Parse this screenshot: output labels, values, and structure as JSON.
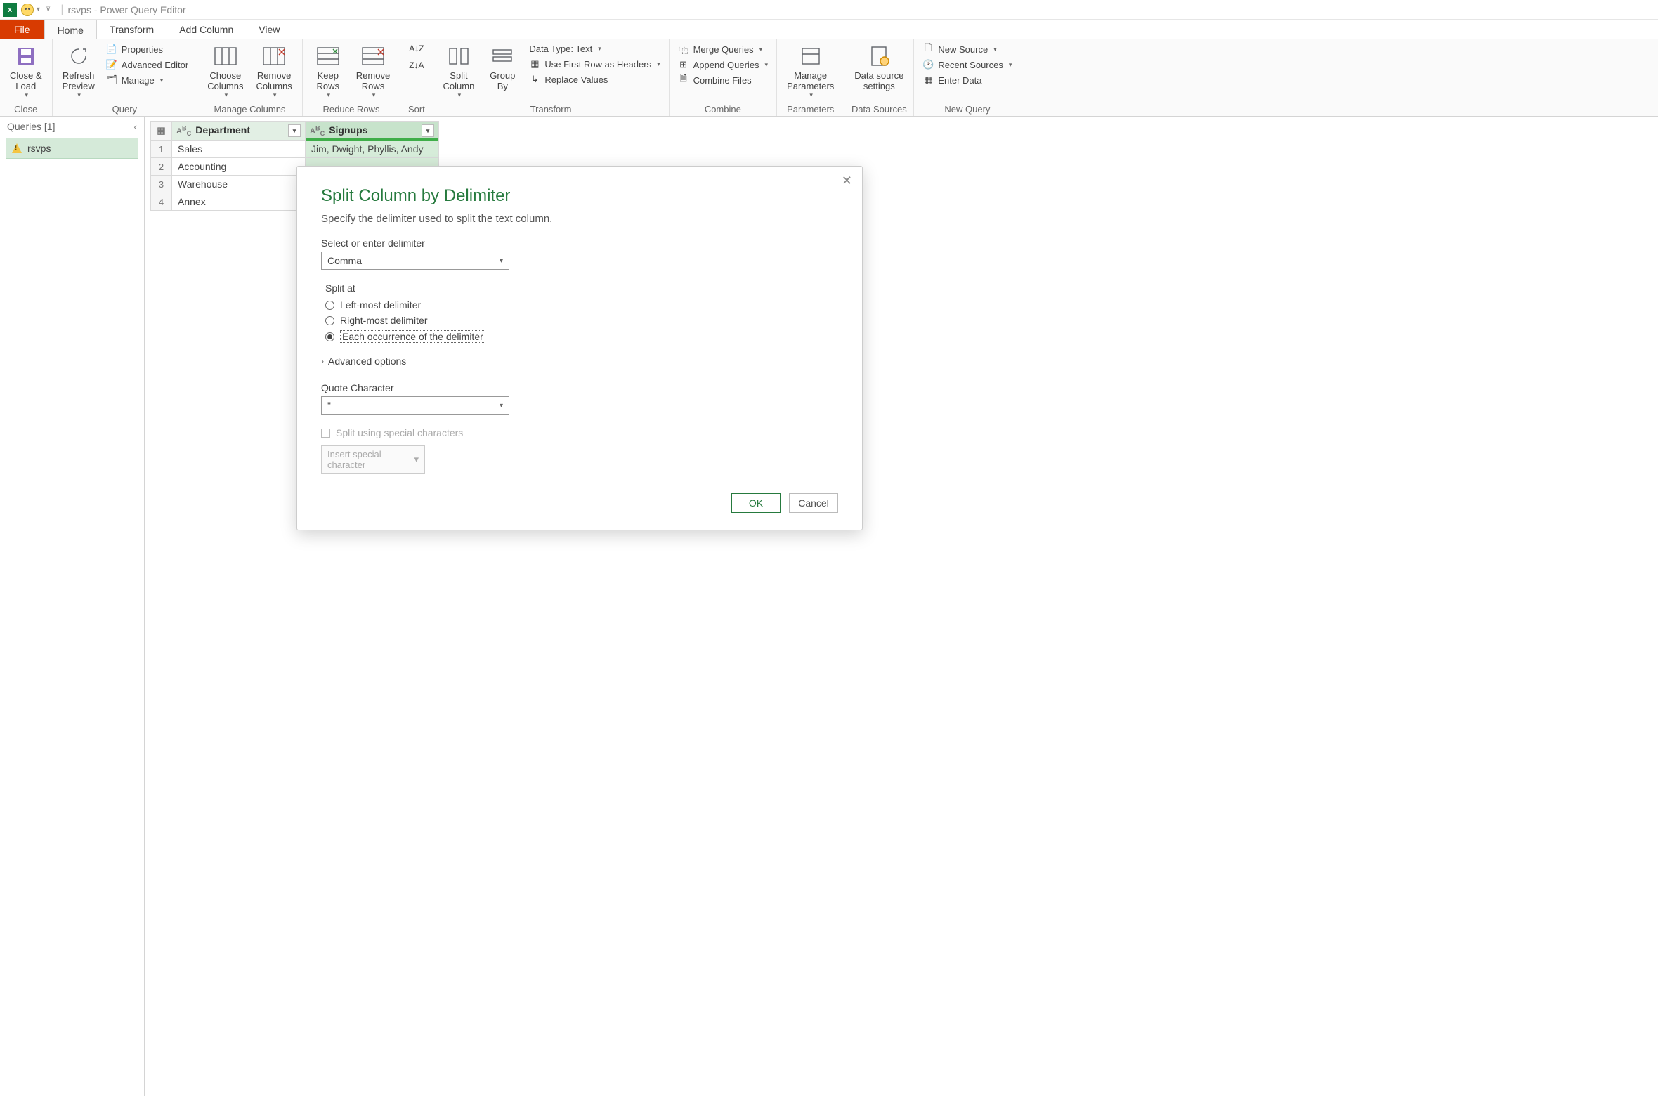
{
  "titlebar": {
    "title": "rsvps - Power Query Editor"
  },
  "tabs": {
    "file": "File",
    "home": "Home",
    "transform": "Transform",
    "addColumn": "Add Column",
    "view": "View"
  },
  "ribbon": {
    "close": {
      "closeLoad": "Close &\nLoad",
      "group": "Close"
    },
    "query": {
      "refresh": "Refresh\nPreview",
      "properties": "Properties",
      "advanced": "Advanced Editor",
      "manage": "Manage",
      "group": "Query"
    },
    "manageCols": {
      "choose": "Choose\nColumns",
      "remove": "Remove\nColumns",
      "group": "Manage Columns"
    },
    "reduce": {
      "keep": "Keep\nRows",
      "remove": "Remove\nRows",
      "group": "Reduce Rows"
    },
    "sort": {
      "group": "Sort"
    },
    "transform": {
      "split": "Split\nColumn",
      "groupBy": "Group\nBy",
      "dataType": "Data Type: Text",
      "firstRow": "Use First Row as Headers",
      "replace": "Replace Values",
      "group": "Transform"
    },
    "combine": {
      "merge": "Merge Queries",
      "append": "Append Queries",
      "files": "Combine Files",
      "group": "Combine"
    },
    "params": {
      "manage": "Manage\nParameters",
      "group": "Parameters"
    },
    "dataSources": {
      "settings": "Data source\nsettings",
      "group": "Data Sources"
    },
    "newQuery": {
      "newSource": "New Source",
      "recent": "Recent Sources",
      "enter": "Enter Data",
      "group": "New Query"
    }
  },
  "sidebar": {
    "header": "Queries [1]",
    "item": "rsvps"
  },
  "grid": {
    "columns": [
      {
        "type": "ABC",
        "name": "Department"
      },
      {
        "type": "ABC",
        "name": "Signups"
      }
    ],
    "rows": [
      {
        "n": "1",
        "c1": "Sales",
        "c2": "Jim, Dwight, Phyllis, Andy"
      },
      {
        "n": "2",
        "c1": "Accounting",
        "c2": ""
      },
      {
        "n": "3",
        "c1": "Warehouse",
        "c2": ""
      },
      {
        "n": "4",
        "c1": "Annex",
        "c2": ""
      }
    ]
  },
  "dialog": {
    "title": "Split Column by Delimiter",
    "subtitle": "Specify the delimiter used to split the text column.",
    "delimLabel": "Select or enter delimiter",
    "delimValue": "Comma",
    "splitAtLabel": "Split at",
    "opt1": "Left-most delimiter",
    "opt2": "Right-most delimiter",
    "opt3": "Each occurrence of the delimiter",
    "advanced": "Advanced options",
    "quoteLabel": "Quote Character",
    "quoteValue": "\"",
    "specialCheck": "Split using special characters",
    "insertSpecial": "Insert special character",
    "ok": "OK",
    "cancel": "Cancel"
  }
}
